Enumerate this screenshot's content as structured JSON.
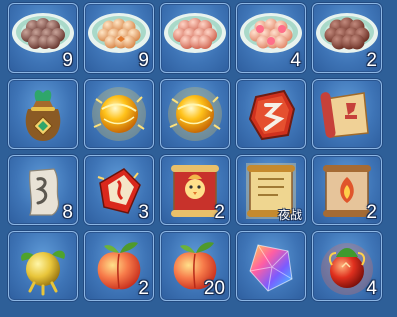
{
  "inventory": {
    "slots": [
      {
        "icon": "rice-ball-plate-icon",
        "quantity": "9"
      },
      {
        "icon": "dumpling-plate-icon",
        "quantity": "9"
      },
      {
        "icon": "glutinous-ball-plate-icon",
        "quantity": ""
      },
      {
        "icon": "flower-dumpling-plate-icon",
        "quantity": "4"
      },
      {
        "icon": "sesame-ball-plate-icon",
        "quantity": "2"
      },
      {
        "icon": "lucky-bag-icon",
        "quantity": ""
      },
      {
        "icon": "golden-orb-icon",
        "quantity": ""
      },
      {
        "icon": "golden-orb-icon",
        "quantity": ""
      },
      {
        "icon": "red-rune-stone-icon",
        "quantity": ""
      },
      {
        "icon": "red-seal-scroll-icon",
        "quantity": ""
      },
      {
        "icon": "talisman-paper-icon",
        "quantity": "8"
      },
      {
        "icon": "fire-shard-icon",
        "quantity": "3"
      },
      {
        "icon": "red-chick-scroll-icon",
        "quantity": "2"
      },
      {
        "icon": "golden-war-scroll-icon",
        "quantity": "",
        "tag": "夜战"
      },
      {
        "icon": "flame-talisman-scroll-icon",
        "quantity": "2"
      },
      {
        "icon": "golden-fruit-icon",
        "quantity": ""
      },
      {
        "icon": "peach-icon",
        "quantity": "2"
      },
      {
        "icon": "peach-icon",
        "quantity": "20"
      },
      {
        "icon": "rainbow-crystal-icon",
        "quantity": ""
      },
      {
        "icon": "red-flame-fruit-icon",
        "quantity": "4"
      }
    ]
  },
  "colors": {
    "panel": "#2e5f98",
    "slot": "#3e74b6",
    "slot_border": "#8cb6e4",
    "quantity_text": "#ffffff"
  }
}
